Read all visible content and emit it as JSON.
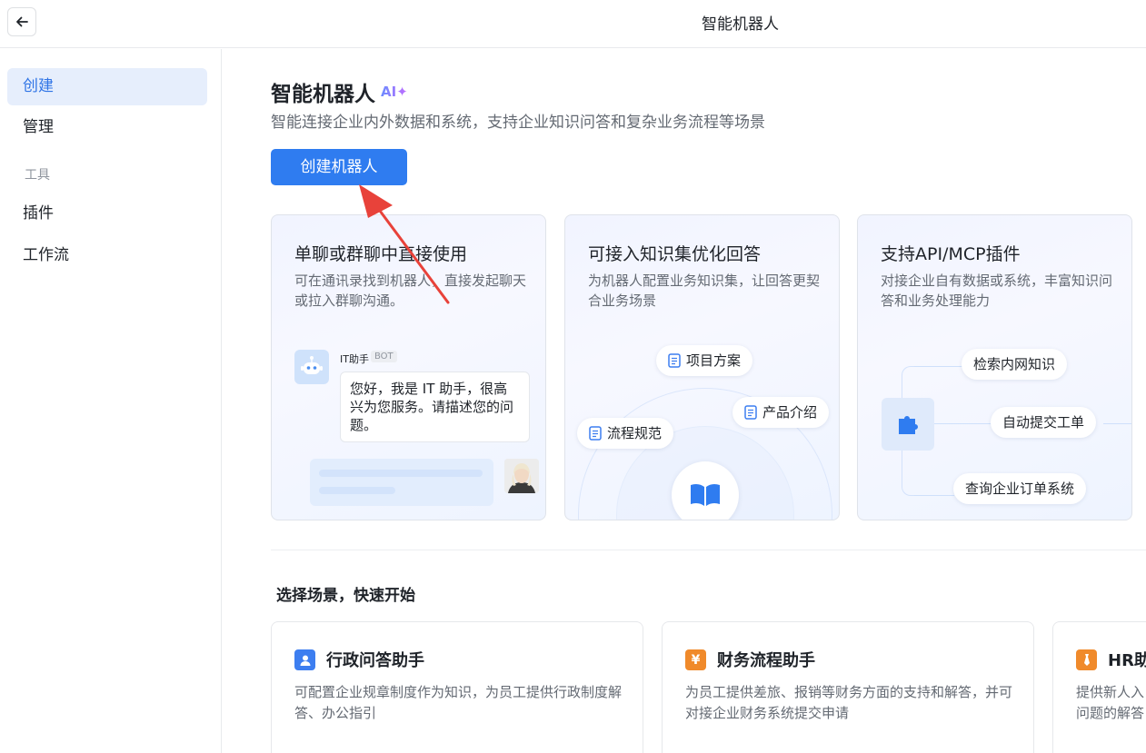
{
  "window": {
    "title": "智能机器人"
  },
  "sidebar": {
    "items": [
      {
        "label": "创建",
        "active": true
      },
      {
        "label": "管理",
        "active": false
      }
    ],
    "group_label": "工具",
    "tool_items": [
      {
        "label": "插件"
      },
      {
        "label": "工作流"
      }
    ]
  },
  "hero": {
    "title": "智能机器人",
    "ai_badge": "AI✦",
    "subtitle": "智能连接企业内外数据和系统，支持企业知识问答和复杂业务流程等场景",
    "create_button": "创建机器人"
  },
  "features": [
    {
      "title": "单聊或群聊中直接使用",
      "desc": "可在通讯录找到机器人，直接发起聊天或拉入群聊沟通。",
      "bot_name": "IT助手",
      "bot_tag": "BOT",
      "bubble": "您好，我是 IT 助手，很高兴为您服务。请描述您的问题。"
    },
    {
      "title": "可接入知识集优化回答",
      "desc": "为机器人配置业务知识集，让回答更契合业务场景",
      "chips": [
        "项目方案",
        "产品介绍",
        "流程规范"
      ]
    },
    {
      "title": "支持API/MCP插件",
      "desc": "对接企业自有数据或系统，丰富知识问答和业务处理能力",
      "chips": [
        "检索内网知识",
        "自动提交工单",
        "查询企业订单系统"
      ]
    }
  ],
  "scenes_section": {
    "title": "选择场景，快速开始"
  },
  "scenes": [
    {
      "title": "行政问答助手",
      "desc": "可配置企业规章制度作为知识，为员工提供行政制度解答、办公指引",
      "color": "#3d7ef0",
      "icon": "person-icon"
    },
    {
      "title": "财务流程助手",
      "desc": "为员工提供差旅、报销等财务方面的支持和解答，并可对接企业财务系统提交申请",
      "color": "#f08a2b",
      "icon": "yen-icon",
      "icon_glyph": "¥"
    },
    {
      "title": "HR助",
      "desc": "提供新人入问题的解答",
      "color": "#f08a2b",
      "icon": "tie-icon"
    }
  ],
  "colors": {
    "accent": "#2f7cf0",
    "annotation_arrow": "#e8423a"
  }
}
